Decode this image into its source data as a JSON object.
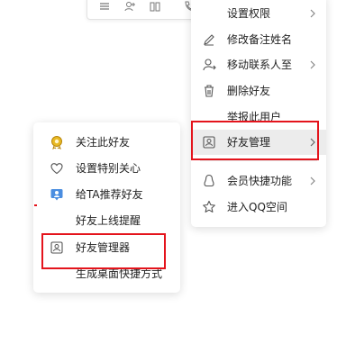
{
  "main_menu": {
    "items": [
      {
        "label": "设置权限",
        "icon": "none",
        "has_submenu": true
      },
      {
        "label": "修改备注姓名",
        "icon": "edit-icon",
        "has_submenu": false
      },
      {
        "label": "移动联系人至",
        "icon": "move-contact-icon",
        "has_submenu": true
      },
      {
        "label": "删除好友",
        "icon": "trash-icon",
        "has_submenu": false
      },
      {
        "label": "举报此用户",
        "icon": "none",
        "has_submenu": false
      },
      {
        "label": "好友管理",
        "icon": "contact-card-icon",
        "has_submenu": true,
        "active": true
      },
      {
        "label": "会员快捷功能",
        "icon": "qq-penguin-icon",
        "has_submenu": true
      },
      {
        "label": "进入QQ空间",
        "icon": "star-icon",
        "has_submenu": false
      }
    ]
  },
  "sub_menu": {
    "items": [
      {
        "label": "关注此好友",
        "icon": "follow-badge-icon"
      },
      {
        "label": "设置特别关心",
        "icon": "heart-icon"
      },
      {
        "label": "给TA推荐好友",
        "icon": "recommend-friend-icon"
      },
      {
        "label": "好友上线提醒",
        "icon": "none"
      },
      {
        "label": "好友管理器",
        "icon": "contact-card-icon",
        "highlighted": true
      },
      {
        "label": "生成桌面快捷方式",
        "icon": "none"
      }
    ]
  },
  "colors": {
    "highlight_box": "#e4141c",
    "hover_bg": "#ececec",
    "icon_stroke": "#555555",
    "follow_icon": "#d4a017",
    "recommend_icon": "#3d7fd6"
  },
  "toolbar": {
    "icons": [
      "menu-icon",
      "add-contact-icon",
      "group-icon",
      "phone-icon"
    ]
  }
}
